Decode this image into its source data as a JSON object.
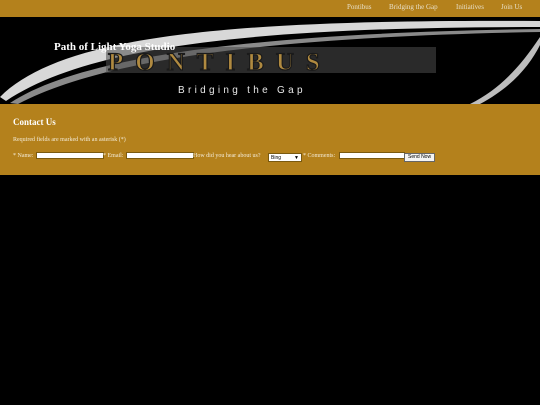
{
  "nav": {
    "items": [
      {
        "label": "Pontibus"
      },
      {
        "label": "Bridging the Gap"
      },
      {
        "label": "Initiatives"
      },
      {
        "label": "Join Us"
      }
    ]
  },
  "banner": {
    "site_title": "Path of Light Yoga Studio",
    "logo_text": "PONTIBUS",
    "tagline": "Bridging the Gap"
  },
  "contact": {
    "heading": "Contact Us",
    "required_note": "Required fields are marked with an asterisk (*)",
    "name_label": "* Name:",
    "name_value": "",
    "email_label": "* Email:",
    "email_value": "",
    "hear_label": "How did you hear about us?",
    "hear_selected": "Bing",
    "comments_label": "* Comments:",
    "comments_value": "",
    "submit_label": "Send Now"
  },
  "colors": {
    "bar": "#b4811c",
    "background": "#000000",
    "text_light": "#f4ecd8"
  }
}
